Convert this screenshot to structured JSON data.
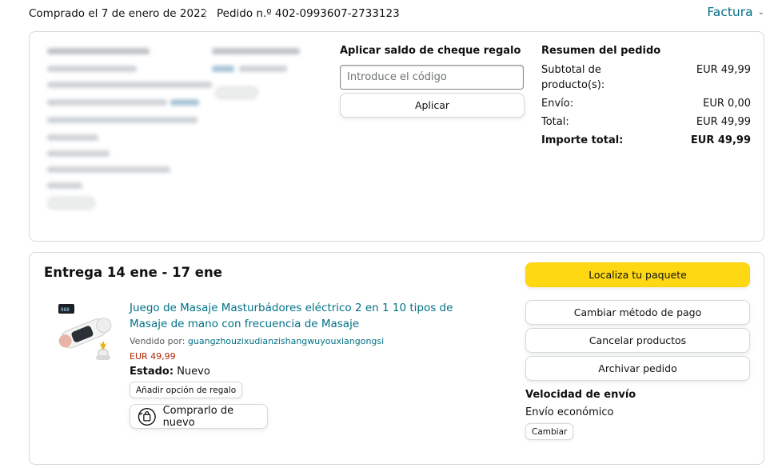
{
  "header": {
    "purchase_date": "Comprado el 7 de enero de 2022",
    "order_number": "Pedido n.º 402-0993607-2733123",
    "invoice_label": "Factura",
    "invoice_icon": "chevron-down-icon"
  },
  "gift_card": {
    "title": "Aplicar saldo de cheque regalo",
    "placeholder": "Introduce el código",
    "apply_label": "Aplicar"
  },
  "summary": {
    "title": "Resumen del pedido",
    "rows": [
      {
        "label": "Subtotal de producto(s):",
        "value": "EUR 49,99"
      },
      {
        "label": "Envío:",
        "value": "EUR 0,00"
      },
      {
        "label": "Total:",
        "value": "EUR 49,99"
      }
    ],
    "grand_total": {
      "label": "Importe total:",
      "value": "EUR 49,99"
    }
  },
  "delivery": {
    "title": "Entrega 14 ene - 17 ene",
    "product": {
      "title": "Juego de Masaje Masturbádores eléctrico 2 en 1 10 tipos de Masaje de mano con frecuencia de Masaje",
      "sold_by_label": "Vendido por:",
      "seller": "guangzhouzixudianzishangwuyouxiangongsi",
      "price": "EUR 49,99",
      "state_label": "Estado:",
      "state_value": "Nuevo",
      "gift_option_label": "Añadir opción de regalo",
      "buy_again_label": "Comprarlo de nuevo"
    },
    "actions": {
      "track": "Localiza tu paquete",
      "change_payment": "Cambiar método de pago",
      "cancel": "Cancelar productos",
      "archive": "Archivar pedido"
    },
    "shipping_speed": {
      "title": "Velocidad de envío",
      "value": "Envío económico",
      "change_label": "Cambiar"
    }
  },
  "colors": {
    "link": "#007185",
    "price": "#b12704",
    "primary_button": "#ffd814",
    "border": "#d5d9d9"
  }
}
